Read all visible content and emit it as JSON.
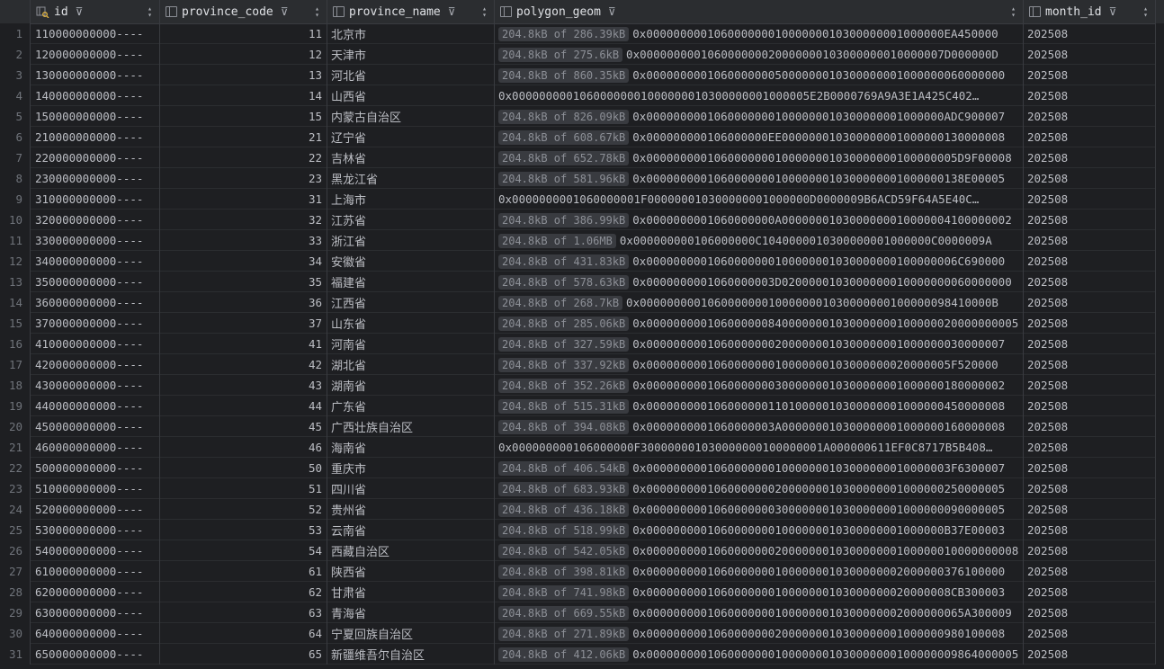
{
  "columns": {
    "id": "id",
    "province_code": "province_code",
    "province_name": "province_name",
    "polygon_geom": "polygon_geom",
    "month_id": "month_id"
  },
  "icons": {
    "filter": "filter-icon",
    "sort": "sort-arrows-icon",
    "key": "primary-key-icon",
    "column": "column-icon"
  },
  "rows": [
    {
      "n": "1",
      "id": "110000000000----",
      "code": "11",
      "name": "北京市",
      "size": "204.8kB of 286.39kB",
      "hex": "0x00000000010600000001000000010300000001000000EA450000",
      "month": "202508"
    },
    {
      "n": "2",
      "id": "120000000000----",
      "code": "12",
      "name": "天津市",
      "size": "204.8kB of 275.6kB",
      "hex": "0x000000000106000000020000000103000000010000007D000000D",
      "month": "202508"
    },
    {
      "n": "3",
      "id": "130000000000----",
      "code": "13",
      "name": "河北省",
      "size": "204.8kB of 860.35kB",
      "hex": "0x00000000010600000005000000010300000001000000060000000",
      "month": "202508"
    },
    {
      "n": "4",
      "id": "140000000000----",
      "code": "14",
      "name": "山西省",
      "size": "",
      "hex": "0x00000000010600000001000000010300000001000005E2B0000769A9A3E1A425C402…",
      "month": "202508"
    },
    {
      "n": "5",
      "id": "150000000000----",
      "code": "15",
      "name": "内蒙古自治区",
      "size": "204.8kB of 826.09kB",
      "hex": "0x00000000010600000001000000010300000001000000ADC900007",
      "month": "202508"
    },
    {
      "n": "6",
      "id": "210000000000----",
      "code": "21",
      "name": "辽宁省",
      "size": "204.8kB of 608.67kB",
      "hex": "0x000000000106000000EE000000010300000001000000130000008",
      "month": "202508"
    },
    {
      "n": "7",
      "id": "220000000000----",
      "code": "22",
      "name": "吉林省",
      "size": "204.8kB of 652.78kB",
      "hex": "0x0000000001060000000100000001030000000100000005D9F00008",
      "month": "202508"
    },
    {
      "n": "8",
      "id": "230000000000----",
      "code": "23",
      "name": "黑龙江省",
      "size": "204.8kB of 581.96kB",
      "hex": "0x00000000010600000001000000010300000001000000138E00005",
      "month": "202508"
    },
    {
      "n": "9",
      "id": "310000000000----",
      "code": "31",
      "name": "上海市",
      "size": "",
      "hex": "0x0000000001060000001F000000010300000001000000D0000009B6ACD59F64A5E40C…",
      "month": "202508"
    },
    {
      "n": "10",
      "id": "320000000000----",
      "code": "32",
      "name": "江苏省",
      "size": "204.8kB of 386.99kB",
      "hex": "0x0000000001060000000A0000000103000000010000004100000002",
      "month": "202508"
    },
    {
      "n": "11",
      "id": "330000000000----",
      "code": "33",
      "name": "浙江省",
      "size": "204.8kB of 1.06MB",
      "hex": "0x000000000106000000C1040000010300000001000000C0000009A",
      "month": "202508"
    },
    {
      "n": "12",
      "id": "340000000000----",
      "code": "34",
      "name": "安徽省",
      "size": "204.8kB of 431.83kB",
      "hex": "0x0000000001060000000100000001030000000100000006C690000",
      "month": "202508"
    },
    {
      "n": "13",
      "id": "350000000000----",
      "code": "35",
      "name": "福建省",
      "size": "204.8kB of 578.63kB",
      "hex": "0x0000000001060000003D0200000103000000010000000060000000",
      "month": "202508"
    },
    {
      "n": "14",
      "id": "360000000000----",
      "code": "36",
      "name": "江西省",
      "size": "204.8kB of 268.7kB",
      "hex": "0x0000000001060000000100000001030000000100000098410000B",
      "month": "202508"
    },
    {
      "n": "15",
      "id": "370000000000----",
      "code": "37",
      "name": "山东省",
      "size": "204.8kB of 285.06kB",
      "hex": "0x0000000001060000008400000001030000000100000020000000005",
      "month": "202508"
    },
    {
      "n": "16",
      "id": "410000000000----",
      "code": "41",
      "name": "河南省",
      "size": "204.8kB of 327.59kB",
      "hex": "0x00000000010600000002000000010300000001000000030000007",
      "month": "202508"
    },
    {
      "n": "17",
      "id": "420000000000----",
      "code": "42",
      "name": "湖北省",
      "size": "204.8kB of 337.92kB",
      "hex": "0x000000000106000000010000000103000000020000005F520000",
      "month": "202508"
    },
    {
      "n": "18",
      "id": "430000000000----",
      "code": "43",
      "name": "湖南省",
      "size": "204.8kB of 352.26kB",
      "hex": "0x00000000010600000003000000010300000001000000180000002",
      "month": "202508"
    },
    {
      "n": "19",
      "id": "440000000000----",
      "code": "44",
      "name": "广东省",
      "size": "204.8kB of 515.31kB",
      "hex": "0x00000000010600000011010000010300000001000000450000008",
      "month": "202508"
    },
    {
      "n": "20",
      "id": "450000000000----",
      "code": "45",
      "name": "广西壮族自治区",
      "size": "204.8kB of 394.08kB",
      "hex": "0x0000000001060000003A000000010300000001000000160000008",
      "month": "202508"
    },
    {
      "n": "21",
      "id": "460000000000----",
      "code": "46",
      "name": "海南省",
      "size": "",
      "hex": "0x000000000106000000F300000001030000000100000001A000000611EF0C8717B5B408…",
      "month": "202508"
    },
    {
      "n": "22",
      "id": "500000000000----",
      "code": "50",
      "name": "重庆市",
      "size": "204.8kB of 406.54kB",
      "hex": "0x000000000106000000010000000103000000010000003F6300007",
      "month": "202508"
    },
    {
      "n": "23",
      "id": "510000000000----",
      "code": "51",
      "name": "四川省",
      "size": "204.8kB of 683.93kB",
      "hex": "0x00000000010600000002000000010300000001000000250000005",
      "month": "202508"
    },
    {
      "n": "24",
      "id": "520000000000----",
      "code": "52",
      "name": "贵州省",
      "size": "204.8kB of 436.18kB",
      "hex": "0x00000000010600000003000000010300000001000000090000005",
      "month": "202508"
    },
    {
      "n": "25",
      "id": "530000000000----",
      "code": "53",
      "name": "云南省",
      "size": "204.8kB of 518.99kB",
      "hex": "0x00000000010600000001000000010300000001000000B37E00003",
      "month": "202508"
    },
    {
      "n": "26",
      "id": "540000000000----",
      "code": "54",
      "name": "西藏自治区",
      "size": "204.8kB of 542.05kB",
      "hex": "0x0000000001060000000200000001030000000100000010000000008",
      "month": "202508"
    },
    {
      "n": "27",
      "id": "610000000000----",
      "code": "61",
      "name": "陕西省",
      "size": "204.8kB of 398.81kB",
      "hex": "0x00000000010600000001000000010300000002000000376100000",
      "month": "202508"
    },
    {
      "n": "28",
      "id": "620000000000----",
      "code": "62",
      "name": "甘肃省",
      "size": "204.8kB of 741.98kB",
      "hex": "0x000000000106000000010000000103000000020000008CB300003",
      "month": "202508"
    },
    {
      "n": "29",
      "id": "630000000000----",
      "code": "63",
      "name": "青海省",
      "size": "204.8kB of 669.55kB",
      "hex": "0x00000000010600000001000000010300000002000000065A300009",
      "month": "202508"
    },
    {
      "n": "30",
      "id": "640000000000----",
      "code": "64",
      "name": "宁夏回族自治区",
      "size": "204.8kB of 271.89kB",
      "hex": "0x00000000010600000002000000010300000001000000980100008",
      "month": "202508"
    },
    {
      "n": "31",
      "id": "650000000000----",
      "code": "65",
      "name": "新疆维吾尔自治区",
      "size": "204.8kB of 412.06kB",
      "hex": "0x0000000001060000000100000001030000000100000009864000005",
      "month": "202508"
    }
  ]
}
